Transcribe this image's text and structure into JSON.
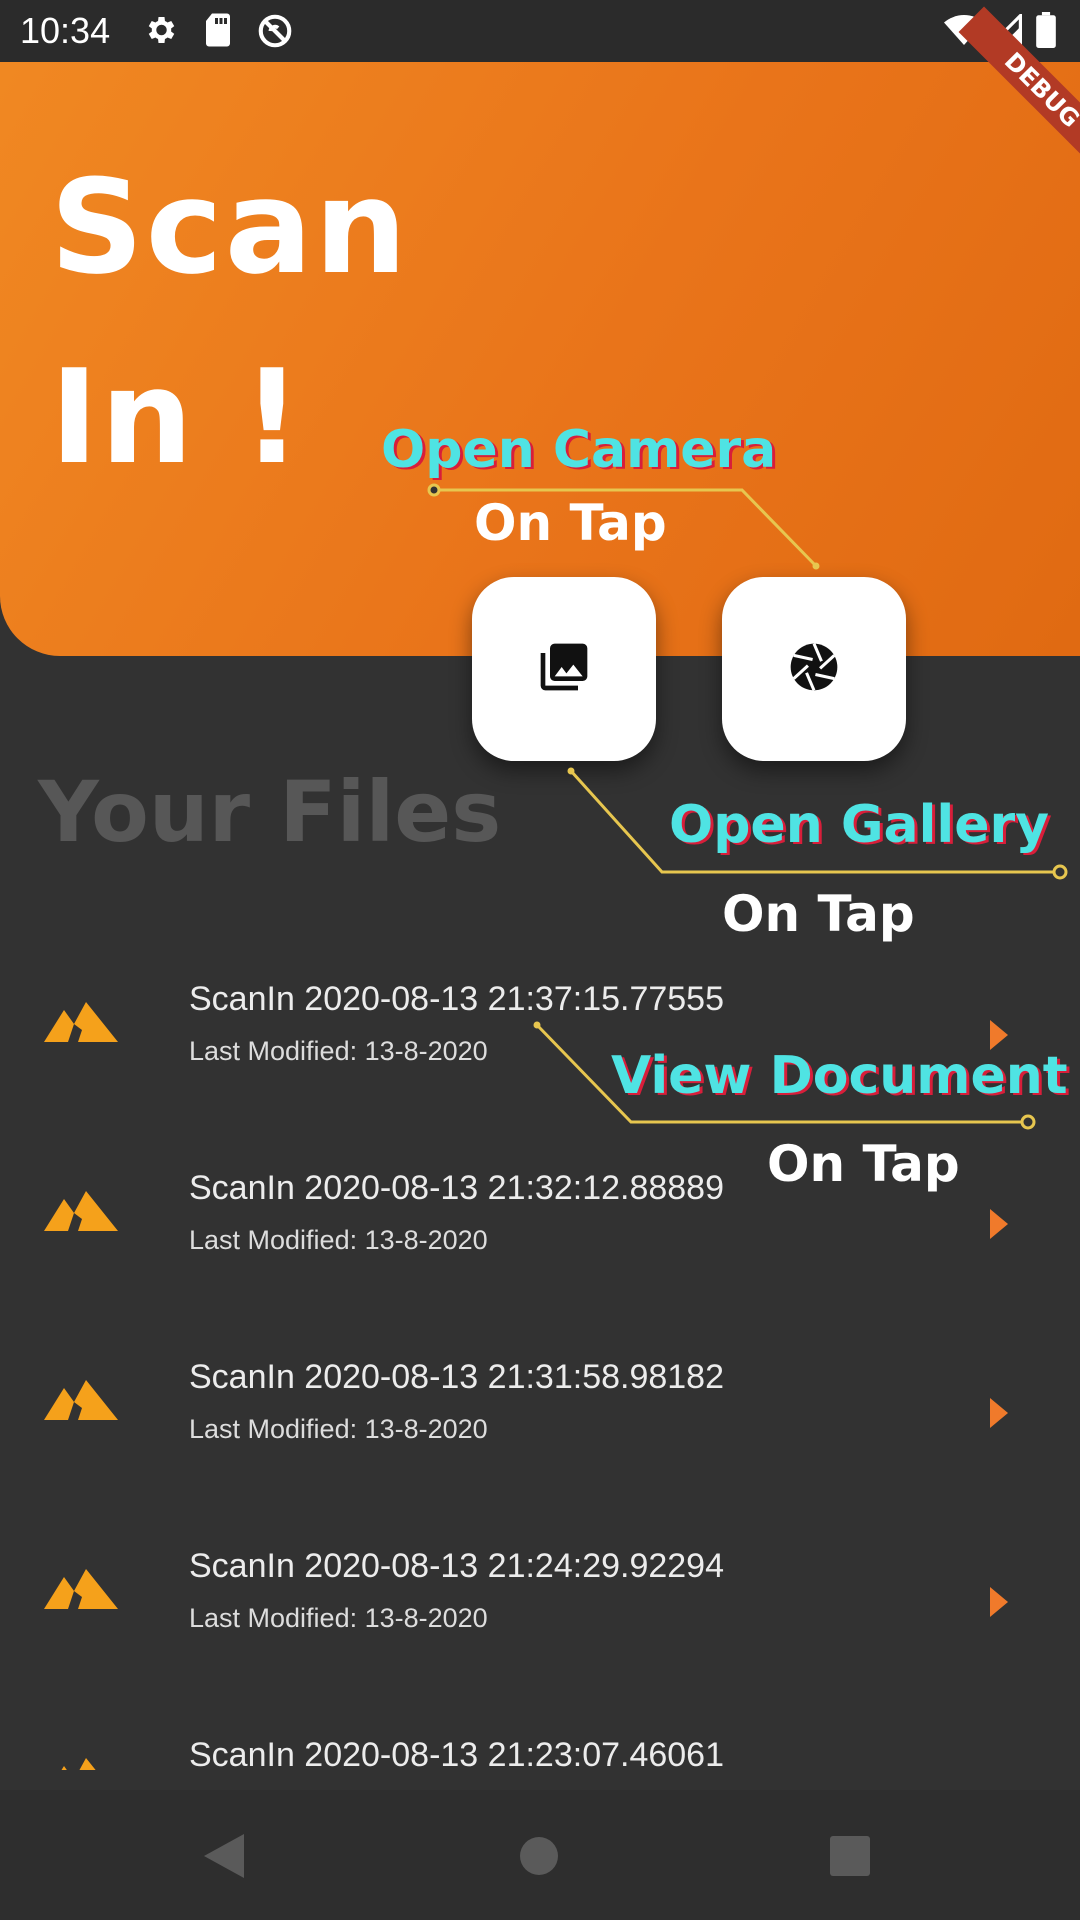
{
  "status_bar": {
    "time": "10:34",
    "left_icons": [
      "gear-icon",
      "sd-card-icon",
      "sync-disabled-icon"
    ],
    "right_icons": [
      "wifi-icon",
      "signal-icon",
      "battery-icon"
    ]
  },
  "header": {
    "title_line1": "Scan",
    "title_line2": "In !",
    "debug_banner": "DEBUG",
    "accent_color": "#e9741a"
  },
  "actions": {
    "gallery_icon": "photo-library-icon",
    "camera_icon": "camera-shutter-icon"
  },
  "section": {
    "title": "Your Files"
  },
  "files": [
    {
      "name": "ScanIn 2020-08-13 21:37:15.77555",
      "meta": "Last Modified: 13-8-2020"
    },
    {
      "name": "ScanIn 2020-08-13 21:32:12.88889",
      "meta": "Last Modified: 13-8-2020"
    },
    {
      "name": "ScanIn 2020-08-13 21:31:58.98182",
      "meta": "Last Modified: 13-8-2020"
    },
    {
      "name": "ScanIn 2020-08-13 21:24:29.92294",
      "meta": "Last Modified: 13-8-2020"
    },
    {
      "name": "ScanIn 2020-08-13 21:23:07.46061",
      "meta": ""
    }
  ],
  "annotations": {
    "camera": {
      "title": "Open Camera",
      "sub": "On Tap"
    },
    "gallery": {
      "title": "Open Gallery",
      "sub": "On Tap"
    },
    "document": {
      "title": "View Document",
      "sub": "On Tap"
    }
  },
  "nav": {
    "back_icon": "back-triangle-icon",
    "home_icon": "home-circle-icon",
    "recents_icon": "recents-square-icon"
  }
}
